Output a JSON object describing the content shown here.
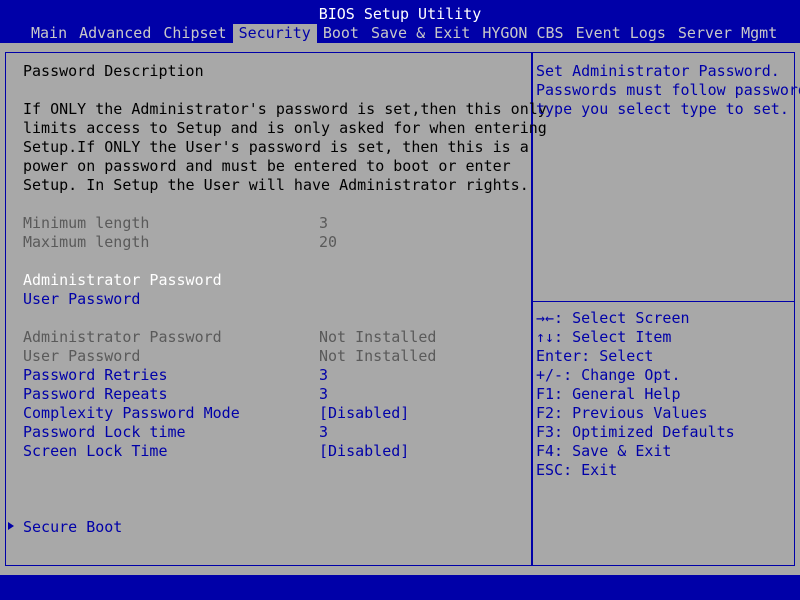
{
  "app": {
    "title": "BIOS Setup Utility"
  },
  "tabs": [
    "Main",
    "Advanced",
    "Chipset",
    "Security",
    "Boot",
    "Save & Exit",
    "HYGON CBS",
    "Event Logs",
    "Server Mgmt"
  ],
  "active_tab": "Security",
  "description": {
    "heading": "Password Description",
    "lines": [
      "If ONLY the Administrator's password is set,then this only",
      "limits access to Setup and is only asked for when entering",
      "Setup.If ONLY the User's password is set, then this is a",
      "power on password and must be entered to boot or enter",
      "Setup. In Setup the User will have Administrator rights."
    ]
  },
  "length": {
    "min_label": "Minimum length",
    "min_value": "3",
    "max_label": "Maximum length",
    "max_value": "20"
  },
  "password_items": {
    "admin": "Administrator Password",
    "user": "User Password"
  },
  "status": {
    "admin_label": "Administrator Password",
    "admin_value": "Not Installed",
    "user_label": "User Password",
    "user_value": "Not Installed"
  },
  "settings": [
    {
      "label": "Password Retries",
      "value": "3"
    },
    {
      "label": "Password Repeats",
      "value": "3"
    },
    {
      "label": "Complexity Password Mode",
      "value": "[Disabled]"
    },
    {
      "label": "Password Lock time",
      "value": "3"
    },
    {
      "label": "Screen Lock Time",
      "value": "[Disabled]"
    }
  ],
  "submenu": {
    "secure_boot": "Secure Boot"
  },
  "help": {
    "lines": [
      "Set Administrator Password.",
      "Passwords must follow password",
      "type you select type to set."
    ]
  },
  "keys": [
    "→←: Select Screen",
    "↑↓: Select Item",
    "Enter: Select",
    "+/-: Change Opt.",
    "F1: General Help",
    "F2: Previous Values",
    "F3: Optimized Defaults",
    "F4: Save & Exit",
    "ESC: Exit"
  ],
  "colors": {
    "background": "#a8a8a8",
    "accent": "#0000a8",
    "highlight": "#ffffff",
    "disabled": "#5a5a5a"
  }
}
